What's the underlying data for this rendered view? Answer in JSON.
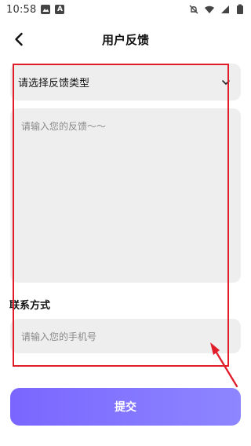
{
  "status_bar": {
    "time": "10:58",
    "a_badge": "A"
  },
  "header": {
    "title": "用户反馈"
  },
  "form": {
    "type_select": {
      "value": "请选择反馈类型"
    },
    "feedback": {
      "placeholder": "请输入您的反馈～～"
    },
    "contact": {
      "label": "联系方式",
      "placeholder": "请输入您的手机号"
    },
    "submit_label": "提交"
  },
  "theme": {
    "accent_start": "#7a66ff",
    "accent_end": "#8d86ff",
    "field_bg": "#eeeeee",
    "annotation": "#e11d2a"
  }
}
